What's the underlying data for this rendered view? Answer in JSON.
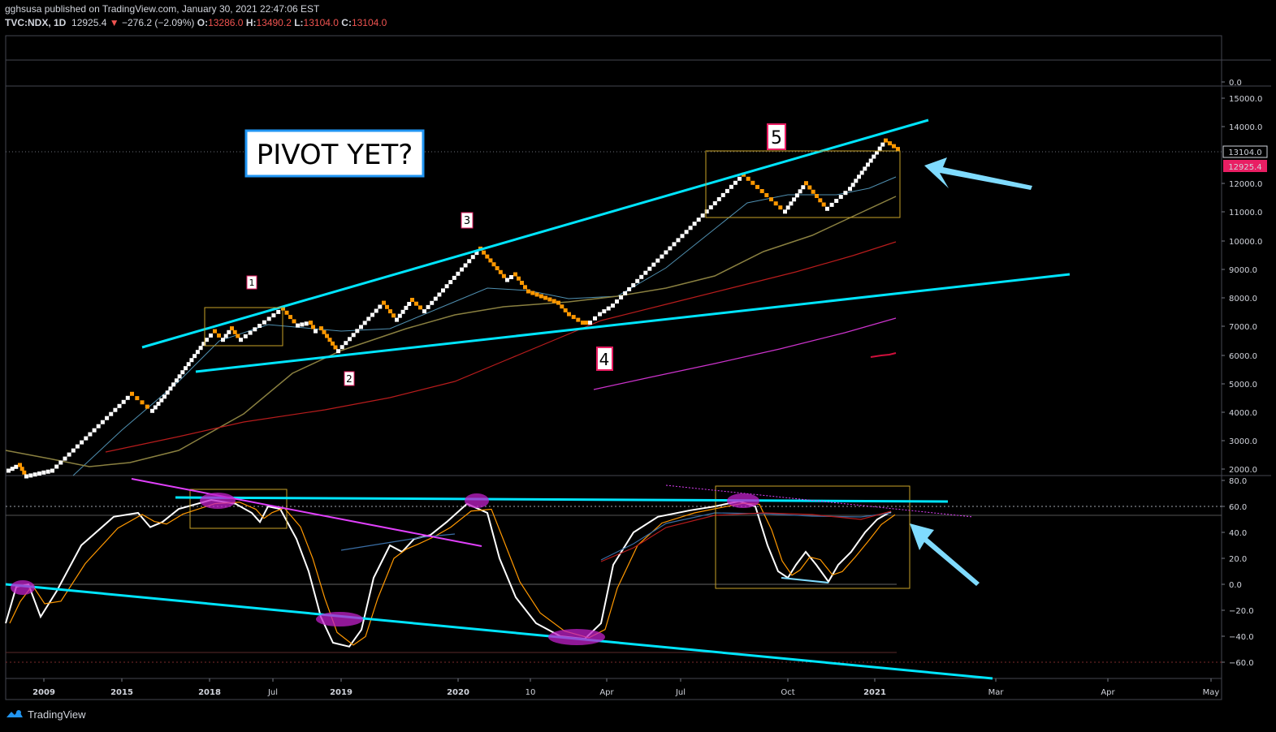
{
  "header": {
    "publisher_line": "gghsusa published on TradingView.com, January 30, 2021 22:47:06 EST",
    "publisher": "gghsusa",
    "symbol": "TVC:NDX, 1D",
    "last": "12925.4",
    "change_arrow": "▼",
    "change": "−276.2 (−2.09%)",
    "o_label": "O:",
    "o_value": "13286.0",
    "h_label": "H:",
    "h_value": "13490.2",
    "l_label": "L:",
    "l_value": "13104.0",
    "c_label": "C:",
    "c_value": "13104.0"
  },
  "annotations": {
    "pivot_text": "PIVOT YET?",
    "wave_labels": [
      "1",
      "2",
      "3",
      "4",
      "5"
    ]
  },
  "price_axis": {
    "ticks": [
      "0.0",
      "15000.0",
      "14000.0",
      "13000.0",
      "12000.0",
      "11000.0",
      "10000.0",
      "9000.0",
      "8000.0",
      "7000.0",
      "6000.0",
      "5000.0",
      "4000.0",
      "3000.0",
      "2000.0"
    ],
    "badge_close": "13104.0",
    "badge_last": "12925.4"
  },
  "osc_axis": {
    "ticks": [
      "80.0",
      "60.0",
      "40.0",
      "20.0",
      "0.0",
      "−20.0",
      "−40.0",
      "−60.0"
    ]
  },
  "time_axis": {
    "labels": [
      "2009",
      "2015",
      "2018",
      "Jul",
      "2019",
      "2020",
      "10",
      "Apr",
      "Jul",
      "Oct",
      "2021",
      "Mar",
      "Apr",
      "May"
    ],
    "bold_labels": [
      "2009",
      "2015",
      "2018",
      "2019",
      "2020",
      "2021"
    ]
  },
  "footer": {
    "brand": "TradingView"
  },
  "colors": {
    "up_brick": "#ffffff",
    "down_brick": "#ff9800",
    "trendline": "#00e5ff",
    "ma_blue": "#4f8fb0",
    "ma_olive": "#8a8040",
    "ma_red": "#b71c1c",
    "ma_magenta": "#cc33cc",
    "box": "#c9a227",
    "last_badge": "#e91e63",
    "arrow": "#7fdbff"
  },
  "chart_data": {
    "type": "renko",
    "symbol": "TVC:NDX",
    "price_range": [
      2000,
      15000
    ],
    "oscillator_range": [
      -60,
      80
    ],
    "key_levels": {
      "last": 12925.4,
      "open": 13286.0,
      "high": 13490.2,
      "low": 13104.0,
      "close": 13104.0
    },
    "wave_pivots": [
      {
        "label": "1",
        "price": 7600
      },
      {
        "label": "2",
        "price": 6100
      },
      {
        "label": "3",
        "price": 9700
      },
      {
        "label": "4",
        "price": 7100
      },
      {
        "label": "5",
        "price": 13500
      }
    ]
  }
}
